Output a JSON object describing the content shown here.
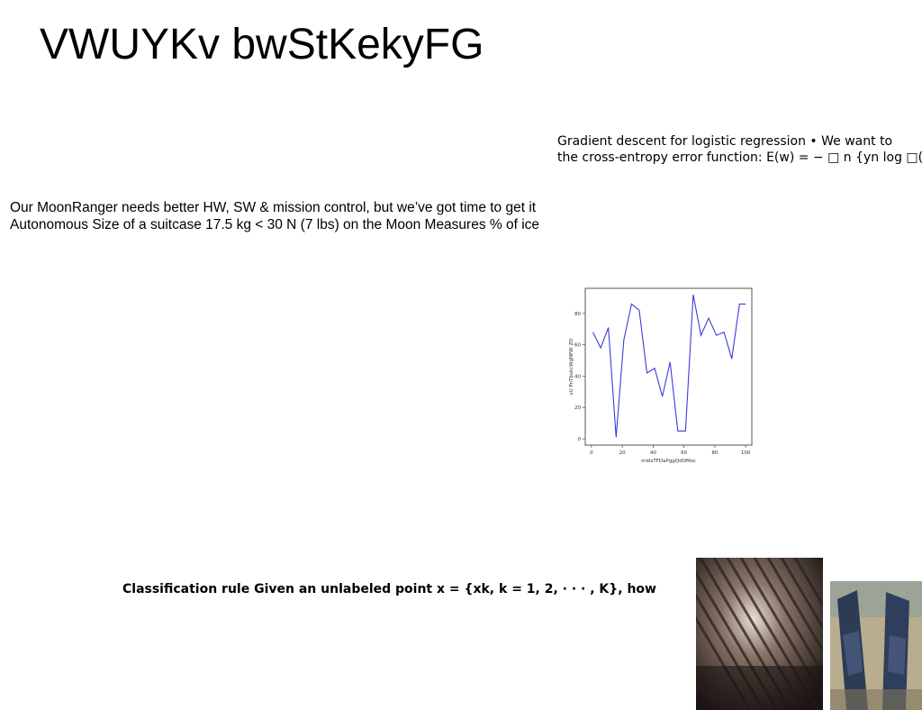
{
  "slide": {
    "title": "VWUYKv bwStKekyFG",
    "gradient_text": {
      "line1": "Gradient descent for logistic regression • We want to",
      "line2": "the cross-entropy error function: E(w) = − □ n {yn log □(w"
    },
    "moon_text": {
      "line1": "Our MoonRanger needs better HW, SW & mission control, but we’ve got time to get it",
      "line2": "Autonomous Size of a suitcase 17.5 kg < 30 N (7 lbs) on the Moon Measures % of ice"
    },
    "classification_text": "Classification rule Given an unlabeled point x = {xk, k = 1, 2, · · · , K}, how",
    "photos": [
      {
        "icon": "tunnel-photo"
      },
      {
        "icon": "legs-in-water-photo"
      }
    ]
  },
  "chart_data": {
    "type": "line",
    "xlabel": "midsTFDaPggQdOMxc",
    "ylabel": "vU PnTbskcWgNFW ZO",
    "xlim": [
      -4,
      104
    ],
    "ylim": [
      -4,
      96
    ],
    "xticks": [
      0,
      20,
      40,
      60,
      80,
      100
    ],
    "yticks": [
      0,
      20,
      40,
      60,
      80
    ],
    "grid": false,
    "color": "#3b3bdc",
    "series": [
      {
        "x": [
          1,
          6,
          11,
          16,
          21,
          26,
          31,
          36,
          41,
          46,
          51,
          56,
          61,
          66,
          71,
          76,
          81,
          86,
          91,
          96,
          100
        ],
        "y": [
          68,
          58,
          71,
          1,
          63,
          86,
          82,
          42,
          45,
          27,
          49,
          5,
          5,
          92,
          66,
          77,
          66,
          68,
          51,
          86,
          86
        ]
      }
    ]
  }
}
